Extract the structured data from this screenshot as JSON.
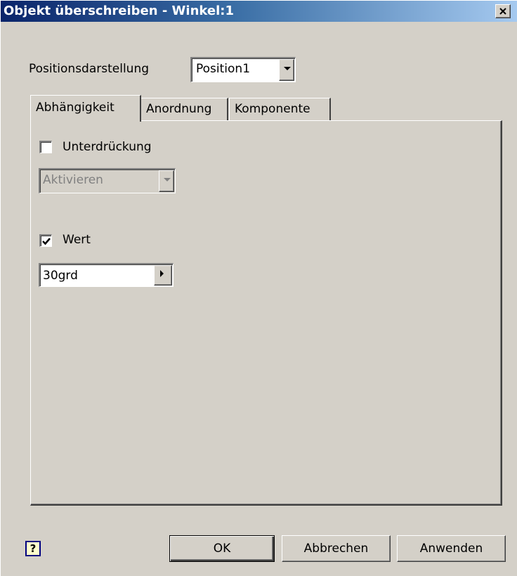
{
  "window": {
    "title": "Objekt überschreiben - Winkel:1",
    "close_glyph": "×"
  },
  "position": {
    "label": "Positionsdarstellung",
    "selected": "Position1"
  },
  "tabs": [
    {
      "label": "Abhängigkeit",
      "active": true
    },
    {
      "label": "Anordnung",
      "active": false
    },
    {
      "label": "Komponente",
      "active": false
    }
  ],
  "suppress": {
    "label": "Unterdrückung",
    "checked": false,
    "dropdown_value": "Aktivieren",
    "dropdown_enabled": false
  },
  "value": {
    "label": "Wert",
    "checked": true,
    "field_value": "30grd"
  },
  "buttons": {
    "help": "?",
    "ok": "OK",
    "cancel": "Abbrechen",
    "apply": "Anwenden"
  },
  "colors": {
    "title_start": "#0a246a",
    "title_end": "#a6caf0",
    "face": "#d4d0c8"
  }
}
